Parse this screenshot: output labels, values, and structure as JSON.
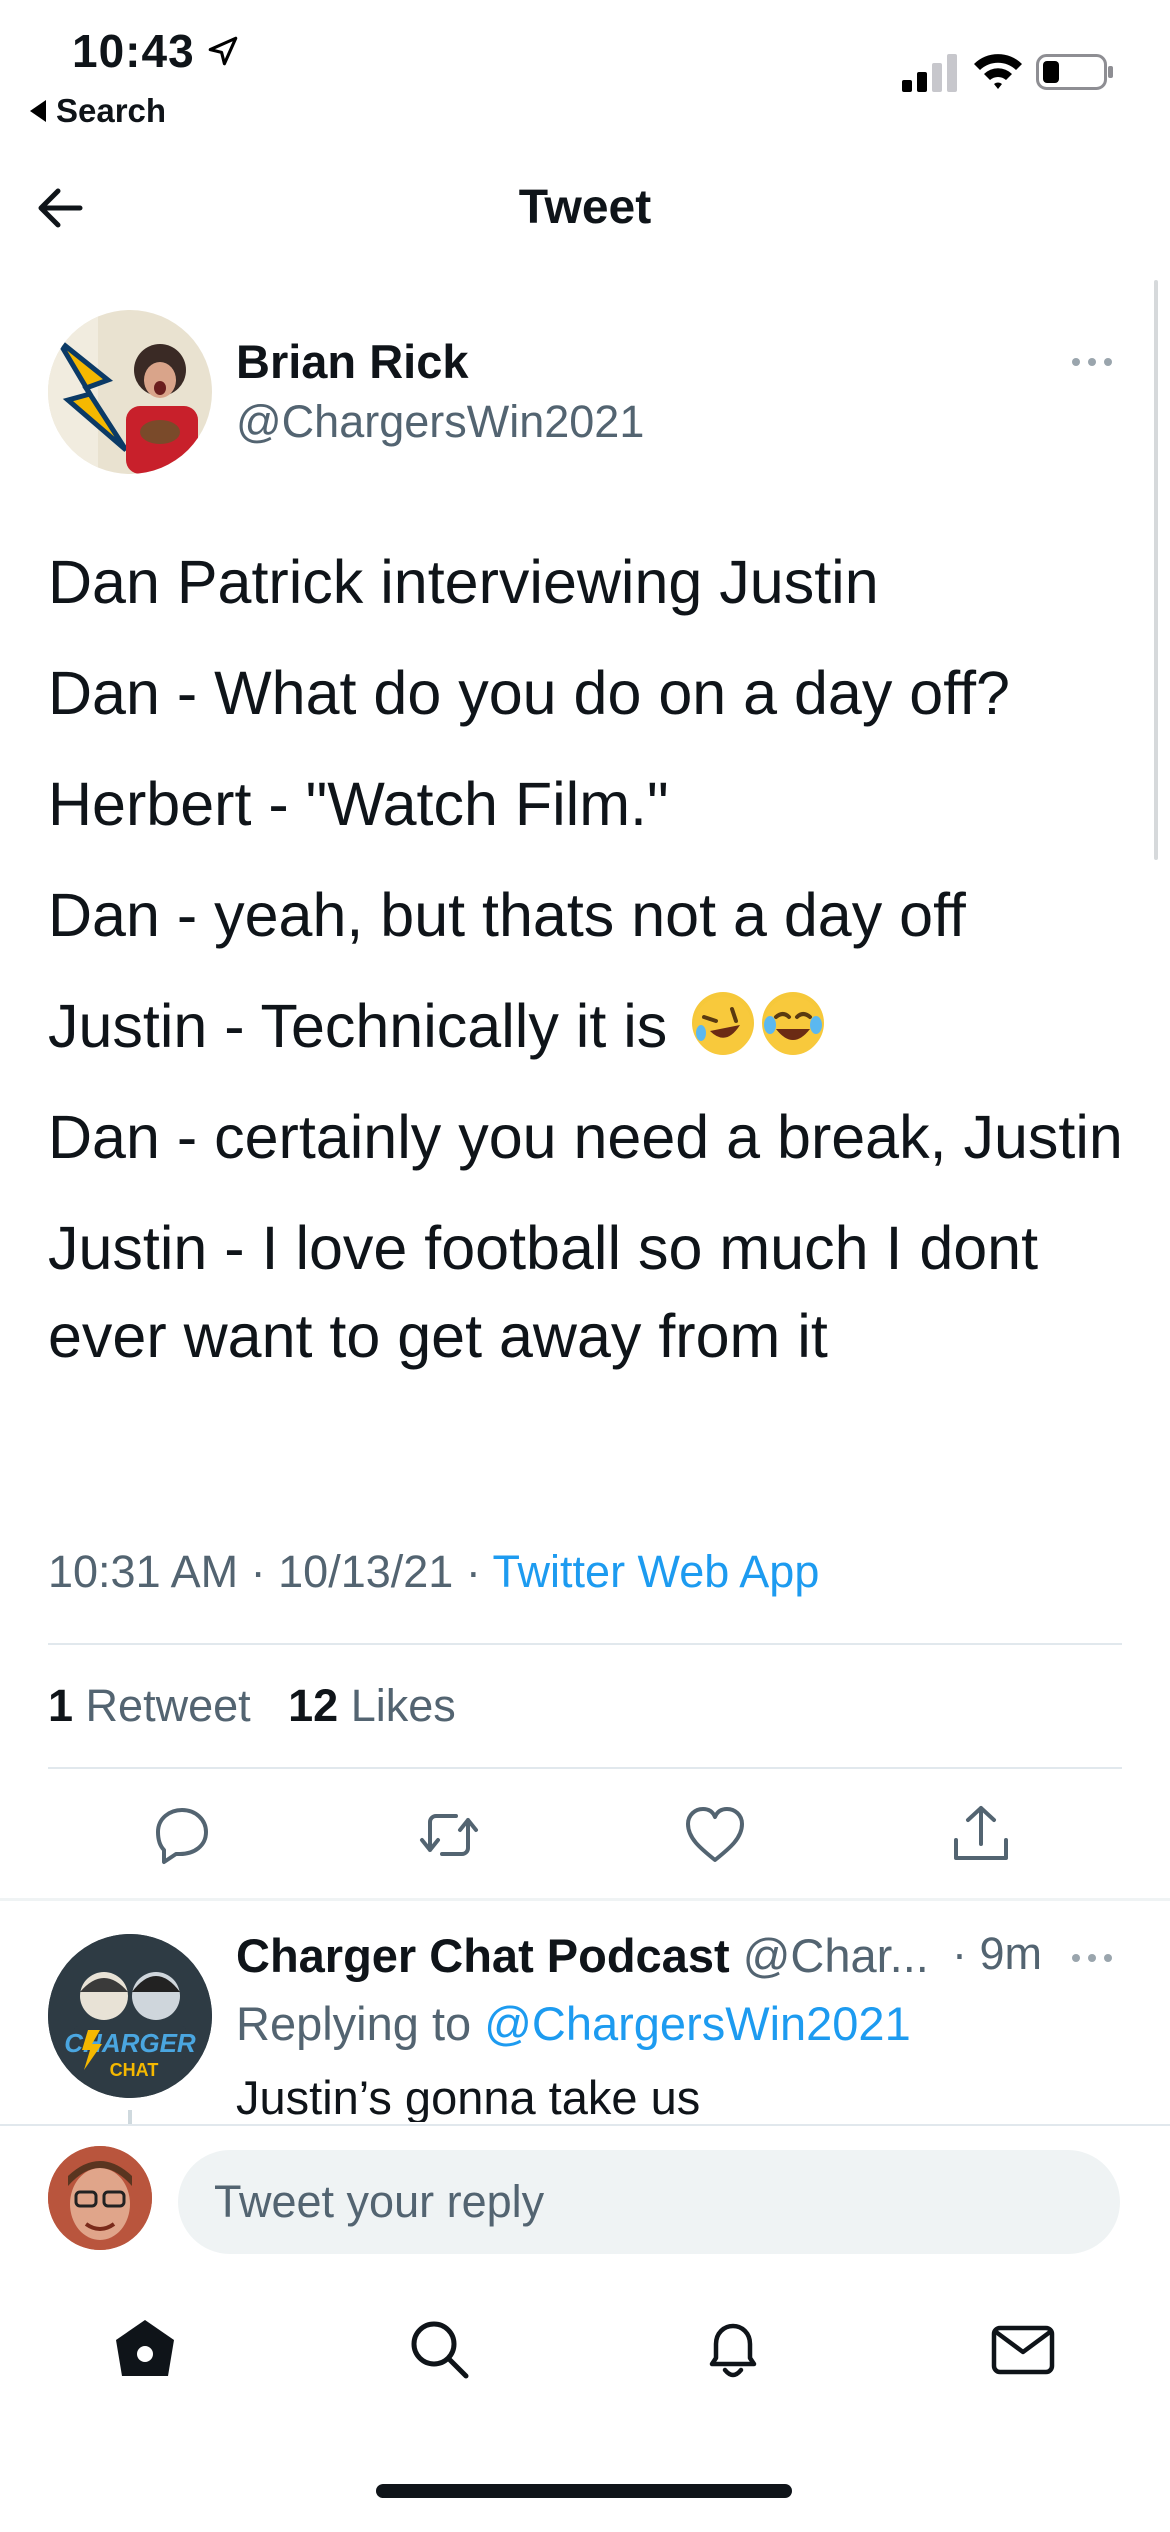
{
  "status_bar": {
    "time": "10:43",
    "back_label": "Search"
  },
  "header": {
    "title": "Tweet"
  },
  "tweet": {
    "author_name": "Brian Rick",
    "author_handle": "@ChargersWin2021",
    "lines": [
      "Dan Patrick interviewing Justin",
      "Dan - What do you do on a day off?",
      "Herbert - \"Watch Film.\"",
      "Dan - yeah, but thats not a day off",
      "Justin  - Technically it is",
      "Dan  - certainly you need a break, Justin",
      "Justin - I love football so much I dont ever want to get away from it"
    ],
    "emojis": [
      "rolling-on-floor-laughing",
      "tears-of-joy"
    ],
    "time": "10:31 AM",
    "date": "10/13/21",
    "source": "Twitter Web App",
    "retweets_count": "1",
    "retweets_label": "Retweet",
    "likes_count": "12",
    "likes_label": "Likes"
  },
  "actions": {
    "icons": [
      "reply-icon",
      "retweet-icon",
      "like-icon",
      "share-icon"
    ]
  },
  "reply": {
    "author_name": "Charger Chat Podcast",
    "author_handle": "@Char...",
    "time": "· 9m",
    "replying_prefix": "Replying to",
    "replying_handle": "@ChargersWin2021",
    "text": "Justin’s gonna take us"
  },
  "compose": {
    "placeholder": "Tweet your reply"
  },
  "tab_bar": {
    "icons": [
      "home-icon",
      "search-icon",
      "notifications-icon",
      "messages-icon"
    ]
  },
  "colors": {
    "accent": "#1d9bf0",
    "secondary_text": "#536471",
    "primary_text": "#0f1419"
  }
}
